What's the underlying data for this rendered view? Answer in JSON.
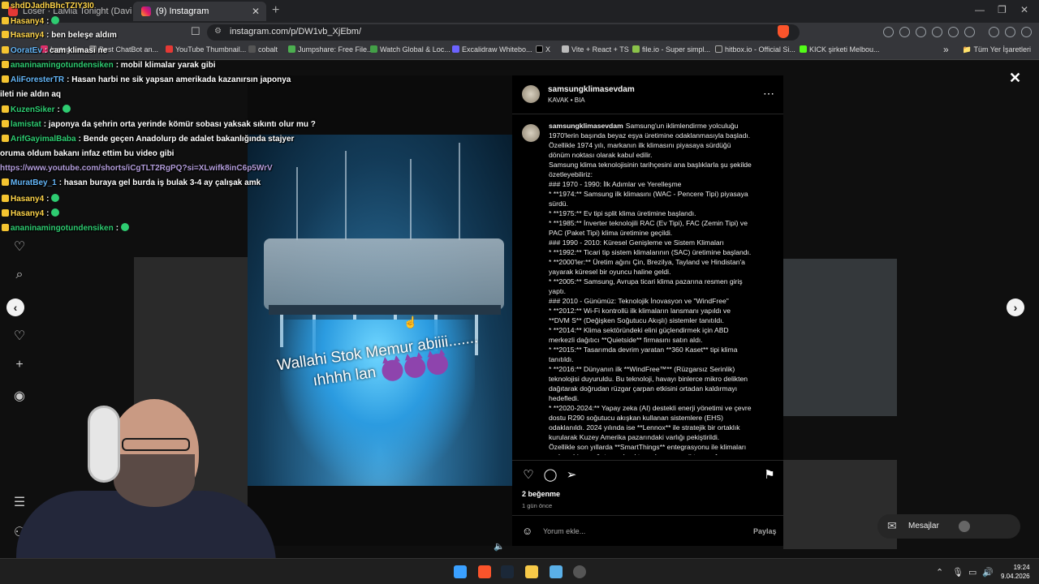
{
  "browser": {
    "tabs": [
      {
        "title": "Loser · LaMia Tonight (David Guetta",
        "active": false
      },
      {
        "title": "(9) Instagram",
        "active": true
      }
    ],
    "url": "instagram.com/p/DW1vb_XjEbm/",
    "bookmarks": [
      "Instagram",
      "Best ChatBot an...",
      "YouTube Thumbnail...",
      "cobalt",
      "Jumpshare: Free File...",
      "Watch Global & Loc...",
      "Excalidraw Whitebo...",
      "X",
      "Vite + React + TS",
      "file.io - Super simpl...",
      "hitbox.io - Official Si...",
      "KICK şirketi Melbou..."
    ],
    "bookmarks_folder": "Tüm Yer İşaretleri"
  },
  "chat": {
    "messages": [
      {
        "user": "shdDJadhBhcTZIY3I0",
        "text": ""
      },
      {
        "user": "Hasany4",
        "text": ":",
        "emote": true
      },
      {
        "user": "Hasany4",
        "text": ": ben beleşe aldım"
      },
      {
        "user": "OoratEv",
        "text": ": cam klimasi ne"
      },
      {
        "user": "ananinamingotundensiken",
        "text": ": mobil klimalar yarak gibi"
      },
      {
        "user": "AliForesterTR",
        "text": ": Hasan harbi ne sik yapsan amerikada kazanırsın japonya"
      },
      {
        "user": "",
        "text": "ileti nie aldın aq"
      },
      {
        "user": "KuzenSiker",
        "text": ":",
        "emote": true
      },
      {
        "user": "lamistat",
        "text": ": japonya da şehrin orta yerinde kömür sobası yaksak sıkıntı olur mu ?"
      },
      {
        "user": "ArifGayimalBaba",
        "text": ": Bende geçen Anadolurp de adalet bakanlığında stajyer"
      },
      {
        "user": "",
        "text": "oruma oldum bakanı infaz ettim bu video gibi"
      },
      {
        "user": "",
        "text": "https://www.youtube.com/shorts/iCgTLT2RgPQ?si=XLwifk8inC6p5WrV",
        "link": true
      },
      {
        "user": "MuratBey_1",
        "text": ": hasan buraya gel burda iş bulak 3-4 ay çalışak amk"
      },
      {
        "user": "Hasany4",
        "text": ":",
        "emote": true
      },
      {
        "user": "Hasany4",
        "text": ":",
        "emote": true
      },
      {
        "user": "ananinamingotundensiken",
        "text": ":",
        "emote": true
      }
    ]
  },
  "post": {
    "author": "samsungklimasevdam",
    "audio": "KAVAK • BIA",
    "video_caption": "Wallahi Stok Memur abiiii.......\nıhhhh lan",
    "caption_lines": [
      "Samsung'un iklimlendirme yolculuğu",
      "1970'lerin başında beyaz eşya üretimine odaklanmasıyla başladı.",
      "Özellikle 1974 yılı, markanın ilk klimasını piyasaya sürdüğü",
      "dönüm noktası olarak kabul edilir.",
      "Samsung klima teknolojisinin tarihçesini ana başlıklarla şu şekilde",
      "özetleyebiliriz:",
      "### 1970 - 1990: İlk Adımlar ve Yerelleşme",
      "* **1974:** Samsung ilk klimasını (WAC - Pencere Tipi) piyasaya",
      "sürdü.",
      "* **1975:** Ev tipi split klima üretimine başlandı.",
      "* **1985:** İnverter teknolojili RAC (Ev Tipi), FAC (Zemin Tipi) ve",
      "PAC (Paket Tipi) klima üretimine geçildi.",
      "### 1990 - 2010: Küresel Genişleme ve Sistem Klimaları",
      "* **1992:** Ticari tip sistem klimalarının (SAC) üretimine başlandı.",
      "* **2000'ler:** Üretim ağını Çin, Brezilya, Tayland ve Hindistan'a",
      "yayarak küresel bir oyuncu haline geldi.",
      "* **2005:** Samsung, Avrupa ticari klima pazarına resmen giriş",
      "yaptı.",
      "### 2010 - Günümüz: Teknolojik İnovasyon ve \"WindFree\"",
      "* **2012:** Wi-Fi kontrollü ilk klimaların lansmanı yapıldı ve",
      "**DVM S** (Değişken Soğutucu Akışlı) sistemler tanıtıldı.",
      "* **2014:** Klima sektöründeki elini güçlendirmek için ABD",
      "merkezli dağıtıcı **Quietside** firmasını satın aldı.",
      "* **2015:** Tasarımda devrim yaratan **360 Kaset** tipi klima",
      "tanıtıldı.",
      "* **2016:** Dünyanın ilk **WindFree™** (Rüzgarsız Serinlik)",
      "teknolojisi duyuruldu. Bu teknoloji, havayı binlerce mikro delikten",
      "dağıtarak doğrudan rüzgar çarpan etkisini ortadan kaldırmayı",
      "hedefledi.",
      "* **2020-2024:** Yapay zeka (AI) destekli enerji yönetimi ve çevre",
      "dostu R290 soğutucu akışkan kullanan sistemlere (EHS)",
      "odaklanıldı. 2024 yılında ise **Lennox** ile stratejik bir ortaklık",
      "kurularak Kuzey Amerika pazarındaki varlığı pekiştirildi.",
      "Özellikle son yıllarda **SmartThings** entegrasyonu ile klimaları",
      "sadece birer soğutucu olmaktan çıkarıp, enerji tasarrufu yapan"
    ],
    "likes": "2 beğenme",
    "time": "1 gün önce",
    "comment_placeholder": "Yorum ekle...",
    "share_label": "Paylaş"
  },
  "messages_pill": {
    "label": "Mesajlar"
  },
  "taskbar": {
    "time": "19:24",
    "date": "9.04.2026"
  }
}
